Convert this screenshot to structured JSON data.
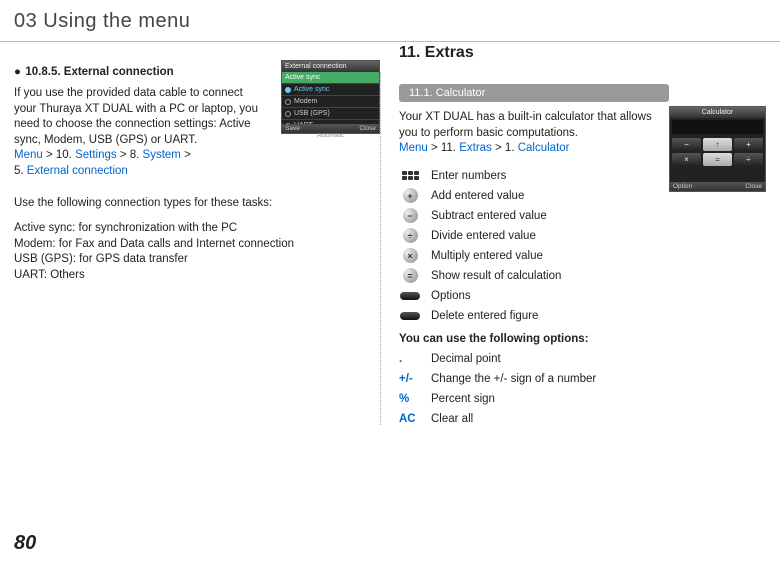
{
  "header": {
    "title": "03 Using the menu"
  },
  "left": {
    "subheading_bullet": "●",
    "subheading": "10.8.5. External connection",
    "para_prefix": "If you use the provided data cable to connect your Thuraya XT DUAL with a PC or laptop, you need to choose the connection settings: Active sync, Modem, USB (GPS) or UART.",
    "menu": "Menu",
    "gt1": " > 10. ",
    "settings": "Settings",
    "gt2": " > 8. ",
    "system": "System",
    "gt3": " > ",
    "five": "5. ",
    "ext_conn": "External connection",
    "types_intro": "Use the following connection types for these tasks:",
    "types": [
      "Active sync: for synchronization with the PC",
      "Modem: for Fax and Data calls and Internet connection",
      "USB (GPS): for GPS data transfer",
      "UART: Others"
    ],
    "screen": {
      "title": "External connection",
      "sub": "Active sync",
      "r1": "Active sync",
      "r2": "Modem",
      "r3": "USB (GPS)",
      "r4": "UART",
      "auto": "Automatic",
      "foot_l": "Save",
      "foot_r": "Close"
    }
  },
  "right": {
    "section_title": "11. Extras",
    "pill": "11.1. Calculator",
    "para": "Your XT DUAL has a built-in calculator that allows you to perform basic computations.",
    "menu": "Menu",
    "gt1": " > 11. ",
    "extras": "Extras",
    "gt2": " > 1. ",
    "calculator": "Calculator",
    "calc_screen": {
      "title": "Calculator",
      "foot_l": "Option",
      "foot_r": "Close"
    },
    "funcs": [
      {
        "icon": "keypad",
        "label": "Enter numbers"
      },
      {
        "icon": "plus",
        "label": "Add entered value"
      },
      {
        "icon": "minus",
        "label": "Subtract entered value"
      },
      {
        "icon": "divide",
        "label": "Divide entered value"
      },
      {
        "icon": "multiply",
        "label": "Multiply entered value"
      },
      {
        "icon": "equals",
        "label": "Show result of calculation"
      },
      {
        "icon": "pill",
        "label": "Options"
      },
      {
        "icon": "pill",
        "label": "Delete entered figure"
      }
    ],
    "opts_heading": "You can use the following options:",
    "opts": [
      {
        "sym": ".",
        "desc": "Decimal point"
      },
      {
        "sym": "+/-",
        "desc": "Change the +/- sign of a number"
      },
      {
        "sym": "%",
        "desc": "Percent sign"
      },
      {
        "sym": "AC",
        "desc": "Clear all"
      }
    ]
  },
  "page_number": "80"
}
